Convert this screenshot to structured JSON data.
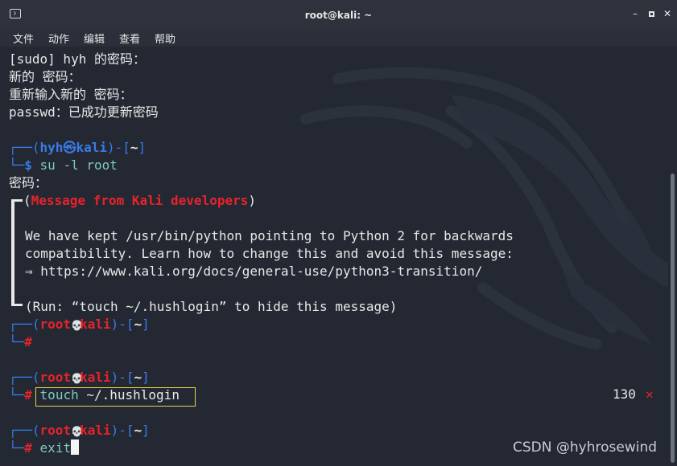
{
  "window": {
    "title": "root@kali: ~",
    "controls": {
      "minimize": "–",
      "close": "✕"
    }
  },
  "menu": [
    "文件",
    "动作",
    "编辑",
    "查看",
    "帮助"
  ],
  "output": {
    "line1": "[sudo] hyh 的密码：",
    "line2": "新的 密码：",
    "line3": "重新输入新的 密码：",
    "line4": "passwd：已成功更新密码"
  },
  "prompt1": {
    "open": "┌──(",
    "user": "hyh",
    "sep": "㉿",
    "host": "kali",
    "close": ")-[",
    "dir": "~",
    "end": "]",
    "corner": "└─",
    "symbol": "$",
    "command_name": "su",
    "command_args": " -l root"
  },
  "password_prompt": "密码：",
  "banner": {
    "open": "(",
    "title": "Message from Kali developers",
    "close": ")",
    "body1": "We have kept /usr/bin/python pointing to Python 2 for backwards",
    "body2": "compatibility. Learn how to change this and avoid this message:",
    "body3": "⇒ https://www.kali.org/docs/general-use/python3-transition/",
    "footer": "(Run: “touch ~/.hushlogin” to hide this message)"
  },
  "prompt_root": {
    "open": "┌──(",
    "user": "root",
    "sep": "💀",
    "host": "kali",
    "close": ")-[",
    "dir": "~",
    "end": "]",
    "corner": "└─",
    "symbol": "#"
  },
  "commands": {
    "touch_name": "touch",
    "touch_args": " ~/.hushlogin",
    "exit_name": "exit"
  },
  "status": {
    "code": "130",
    "icon": "✕"
  },
  "watermark": "CSDN @hyhrosewind",
  "colors": {
    "background": "#232833",
    "prompt_blue": "#3a7be6",
    "root_red": "#e8232b",
    "command": "#7ec9c0",
    "highlight": "#e8d44d"
  }
}
